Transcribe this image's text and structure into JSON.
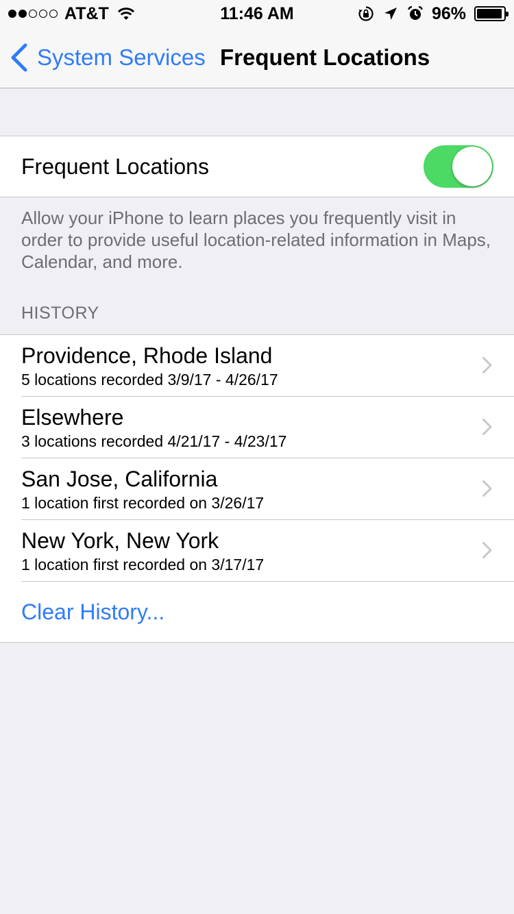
{
  "status_bar": {
    "carrier": "AT&T",
    "time": "11:46 AM",
    "battery_percent": "96%",
    "battery_level": 0.96,
    "signal_bars_filled": 2,
    "signal_bars_total": 5
  },
  "nav": {
    "back_label": "System Services",
    "title": "Frequent Locations"
  },
  "toggle": {
    "label": "Frequent Locations",
    "on": true,
    "on_color": "#4cd964"
  },
  "footer": "Allow your iPhone to learn places you frequently visit in order to provide useful location-related information in Maps, Calendar, and more.",
  "history": {
    "header": "HISTORY",
    "items": [
      {
        "title": "Providence, Rhode Island",
        "subtitle": "5 locations recorded 3/9/17 - 4/26/17"
      },
      {
        "title": "Elsewhere",
        "subtitle": "3 locations recorded 4/21/17 - 4/23/17"
      },
      {
        "title": "San Jose, California",
        "subtitle": "1 location first recorded on 3/26/17"
      },
      {
        "title": "New York, New York",
        "subtitle": "1 location first recorded on 3/17/17"
      }
    ],
    "clear_label": "Clear History..."
  },
  "colors": {
    "accent": "#2f7cf6",
    "background": "#efeff4",
    "secondary_text": "#6d6d72"
  }
}
